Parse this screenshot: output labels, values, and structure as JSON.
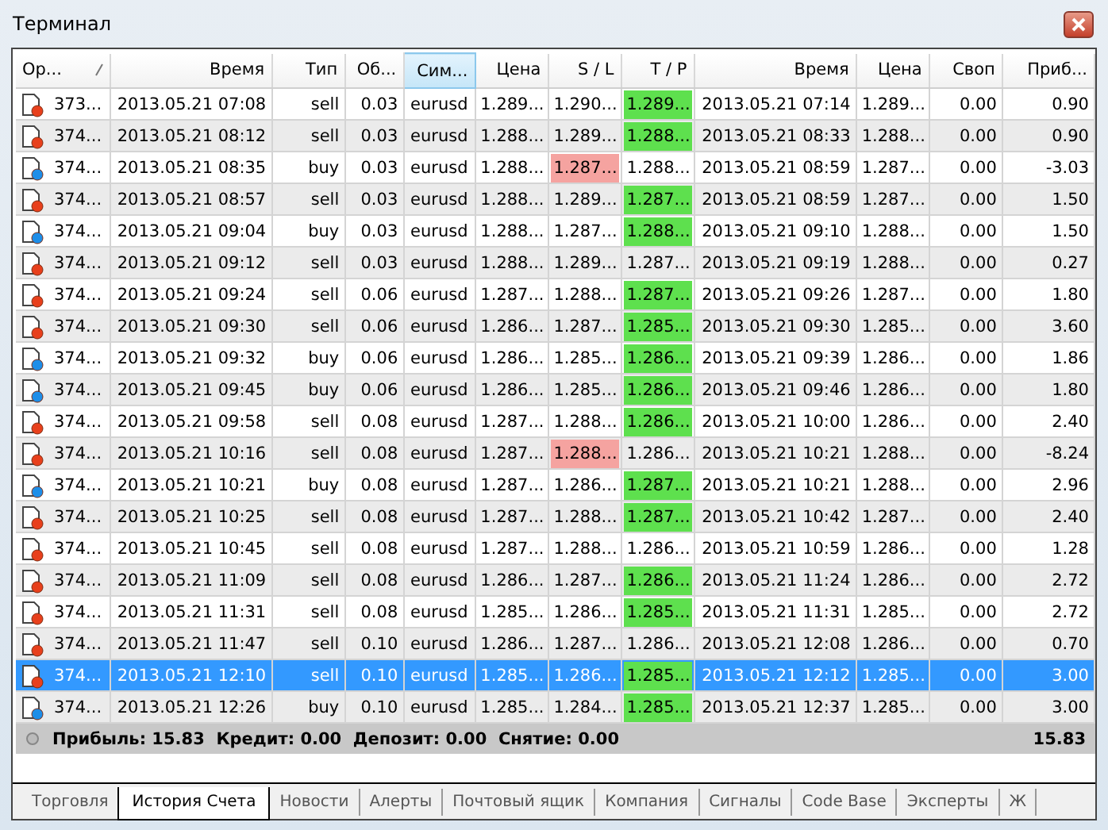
{
  "window": {
    "title": "Терминал"
  },
  "columns": [
    {
      "label": "Ор...",
      "sorted": true,
      "highlighted": false
    },
    {
      "label": "Время",
      "sorted": false,
      "highlighted": false
    },
    {
      "label": "Тип",
      "sorted": false,
      "highlighted": false
    },
    {
      "label": "Об...",
      "sorted": false,
      "highlighted": false
    },
    {
      "label": "Сим...",
      "sorted": false,
      "highlighted": true
    },
    {
      "label": "Цена",
      "sorted": false,
      "highlighted": false
    },
    {
      "label": "S / L",
      "sorted": false,
      "highlighted": false
    },
    {
      "label": "T / P",
      "sorted": false,
      "highlighted": false
    },
    {
      "label": "Время",
      "sorted": false,
      "highlighted": false
    },
    {
      "label": "Цена",
      "sorted": false,
      "highlighted": false
    },
    {
      "label": "Своп",
      "sorted": false,
      "highlighted": false
    },
    {
      "label": "Приб...",
      "sorted": false,
      "highlighted": false
    }
  ],
  "rows": [
    {
      "kind": "sell",
      "selected": false,
      "sl_hit": false,
      "tp_hit": true,
      "cells": [
        "373...",
        "2013.05.21 07:08",
        "sell",
        "0.03",
        "eurusd",
        "1.289...",
        "1.290...",
        "1.289...",
        "2013.05.21 07:14",
        "1.289...",
        "0.00",
        "0.90"
      ]
    },
    {
      "kind": "sell",
      "selected": false,
      "sl_hit": false,
      "tp_hit": true,
      "cells": [
        "374...",
        "2013.05.21 08:12",
        "sell",
        "0.03",
        "eurusd",
        "1.288...",
        "1.289...",
        "1.288...",
        "2013.05.21 08:33",
        "1.288...",
        "0.00",
        "0.90"
      ]
    },
    {
      "kind": "buy",
      "selected": false,
      "sl_hit": true,
      "tp_hit": false,
      "cells": [
        "374...",
        "2013.05.21 08:35",
        "buy",
        "0.03",
        "eurusd",
        "1.288...",
        "1.287...",
        "1.288...",
        "2013.05.21 08:59",
        "1.287...",
        "0.00",
        "-3.03"
      ]
    },
    {
      "kind": "sell",
      "selected": false,
      "sl_hit": false,
      "tp_hit": true,
      "cells": [
        "374...",
        "2013.05.21 08:57",
        "sell",
        "0.03",
        "eurusd",
        "1.288...",
        "1.289...",
        "1.287...",
        "2013.05.21 08:59",
        "1.287...",
        "0.00",
        "1.50"
      ]
    },
    {
      "kind": "buy",
      "selected": false,
      "sl_hit": false,
      "tp_hit": true,
      "cells": [
        "374...",
        "2013.05.21 09:04",
        "buy",
        "0.03",
        "eurusd",
        "1.288...",
        "1.287...",
        "1.288...",
        "2013.05.21 09:10",
        "1.288...",
        "0.00",
        "1.50"
      ]
    },
    {
      "kind": "sell",
      "selected": false,
      "sl_hit": false,
      "tp_hit": false,
      "cells": [
        "374...",
        "2013.05.21 09:12",
        "sell",
        "0.03",
        "eurusd",
        "1.288...",
        "1.289...",
        "1.287...",
        "2013.05.21 09:19",
        "1.288...",
        "0.00",
        "0.27"
      ]
    },
    {
      "kind": "sell",
      "selected": false,
      "sl_hit": false,
      "tp_hit": true,
      "cells": [
        "374...",
        "2013.05.21 09:24",
        "sell",
        "0.06",
        "eurusd",
        "1.287...",
        "1.288...",
        "1.287...",
        "2013.05.21 09:26",
        "1.287...",
        "0.00",
        "1.80"
      ]
    },
    {
      "kind": "sell",
      "selected": false,
      "sl_hit": false,
      "tp_hit": true,
      "cells": [
        "374...",
        "2013.05.21 09:30",
        "sell",
        "0.06",
        "eurusd",
        "1.286...",
        "1.287...",
        "1.285...",
        "2013.05.21 09:30",
        "1.285...",
        "0.00",
        "3.60"
      ]
    },
    {
      "kind": "buy",
      "selected": false,
      "sl_hit": false,
      "tp_hit": true,
      "cells": [
        "374...",
        "2013.05.21 09:32",
        "buy",
        "0.06",
        "eurusd",
        "1.286...",
        "1.285...",
        "1.286...",
        "2013.05.21 09:39",
        "1.286...",
        "0.00",
        "1.86"
      ]
    },
    {
      "kind": "buy",
      "selected": false,
      "sl_hit": false,
      "tp_hit": true,
      "cells": [
        "374...",
        "2013.05.21 09:45",
        "buy",
        "0.06",
        "eurusd",
        "1.286...",
        "1.285...",
        "1.286...",
        "2013.05.21 09:46",
        "1.286...",
        "0.00",
        "1.80"
      ]
    },
    {
      "kind": "sell",
      "selected": false,
      "sl_hit": false,
      "tp_hit": true,
      "cells": [
        "374...",
        "2013.05.21 09:58",
        "sell",
        "0.08",
        "eurusd",
        "1.287...",
        "1.288...",
        "1.286...",
        "2013.05.21 10:00",
        "1.286...",
        "0.00",
        "2.40"
      ]
    },
    {
      "kind": "sell",
      "selected": false,
      "sl_hit": true,
      "tp_hit": false,
      "cells": [
        "374...",
        "2013.05.21 10:16",
        "sell",
        "0.08",
        "eurusd",
        "1.287...",
        "1.288...",
        "1.286...",
        "2013.05.21 10:21",
        "1.288...",
        "0.00",
        "-8.24"
      ]
    },
    {
      "kind": "buy",
      "selected": false,
      "sl_hit": false,
      "tp_hit": true,
      "cells": [
        "374...",
        "2013.05.21 10:21",
        "buy",
        "0.08",
        "eurusd",
        "1.287...",
        "1.286...",
        "1.287...",
        "2013.05.21 10:21",
        "1.288...",
        "0.00",
        "2.96"
      ]
    },
    {
      "kind": "sell",
      "selected": false,
      "sl_hit": false,
      "tp_hit": true,
      "cells": [
        "374...",
        "2013.05.21 10:25",
        "sell",
        "0.08",
        "eurusd",
        "1.287...",
        "1.288...",
        "1.287...",
        "2013.05.21 10:42",
        "1.287...",
        "0.00",
        "2.40"
      ]
    },
    {
      "kind": "sell",
      "selected": false,
      "sl_hit": false,
      "tp_hit": false,
      "cells": [
        "374...",
        "2013.05.21 10:45",
        "sell",
        "0.08",
        "eurusd",
        "1.287...",
        "1.288...",
        "1.286...",
        "2013.05.21 10:59",
        "1.286...",
        "0.00",
        "1.28"
      ]
    },
    {
      "kind": "sell",
      "selected": false,
      "sl_hit": false,
      "tp_hit": true,
      "cells": [
        "374...",
        "2013.05.21 11:09",
        "sell",
        "0.08",
        "eurusd",
        "1.286...",
        "1.287...",
        "1.286...",
        "2013.05.21 11:24",
        "1.286...",
        "0.00",
        "2.72"
      ]
    },
    {
      "kind": "sell",
      "selected": false,
      "sl_hit": false,
      "tp_hit": true,
      "cells": [
        "374...",
        "2013.05.21 11:31",
        "sell",
        "0.08",
        "eurusd",
        "1.285...",
        "1.286...",
        "1.285...",
        "2013.05.21 11:31",
        "1.285...",
        "0.00",
        "2.72"
      ]
    },
    {
      "kind": "sell",
      "selected": false,
      "sl_hit": false,
      "tp_hit": false,
      "cells": [
        "374...",
        "2013.05.21 11:47",
        "sell",
        "0.10",
        "eurusd",
        "1.286...",
        "1.287...",
        "1.286...",
        "2013.05.21 12:08",
        "1.286...",
        "0.00",
        "0.70"
      ]
    },
    {
      "kind": "sell",
      "selected": true,
      "sl_hit": false,
      "tp_hit": true,
      "cells": [
        "374...",
        "2013.05.21 12:10",
        "sell",
        "0.10",
        "eurusd",
        "1.285...",
        "1.286...",
        "1.285...",
        "2013.05.21 12:12",
        "1.285...",
        "0.00",
        "3.00"
      ]
    },
    {
      "kind": "buy",
      "selected": false,
      "sl_hit": false,
      "tp_hit": true,
      "cells": [
        "374...",
        "2013.05.21 12:26",
        "buy",
        "0.10",
        "eurusd",
        "1.285...",
        "1.284...",
        "1.285...",
        "2013.05.21 12:37",
        "1.285...",
        "0.00",
        "3.00"
      ]
    }
  ],
  "summary": {
    "text": "Прибыль: 15.83  Кредит: 0.00  Депозит: 0.00  Снятие: 0.00",
    "total": "15.83"
  },
  "tabs": [
    {
      "label": "Торговля",
      "selected": false
    },
    {
      "label": "История Счета",
      "selected": true
    },
    {
      "label": "Новости",
      "selected": false
    },
    {
      "label": "Алерты",
      "selected": false
    },
    {
      "label": "Почтовый ящик",
      "selected": false
    },
    {
      "label": "Компания",
      "selected": false
    },
    {
      "label": "Сигналы",
      "selected": false
    },
    {
      "label": "Code Base",
      "selected": false
    },
    {
      "label": "Эксперты",
      "selected": false
    },
    {
      "label": "Ж",
      "selected": false
    }
  ]
}
